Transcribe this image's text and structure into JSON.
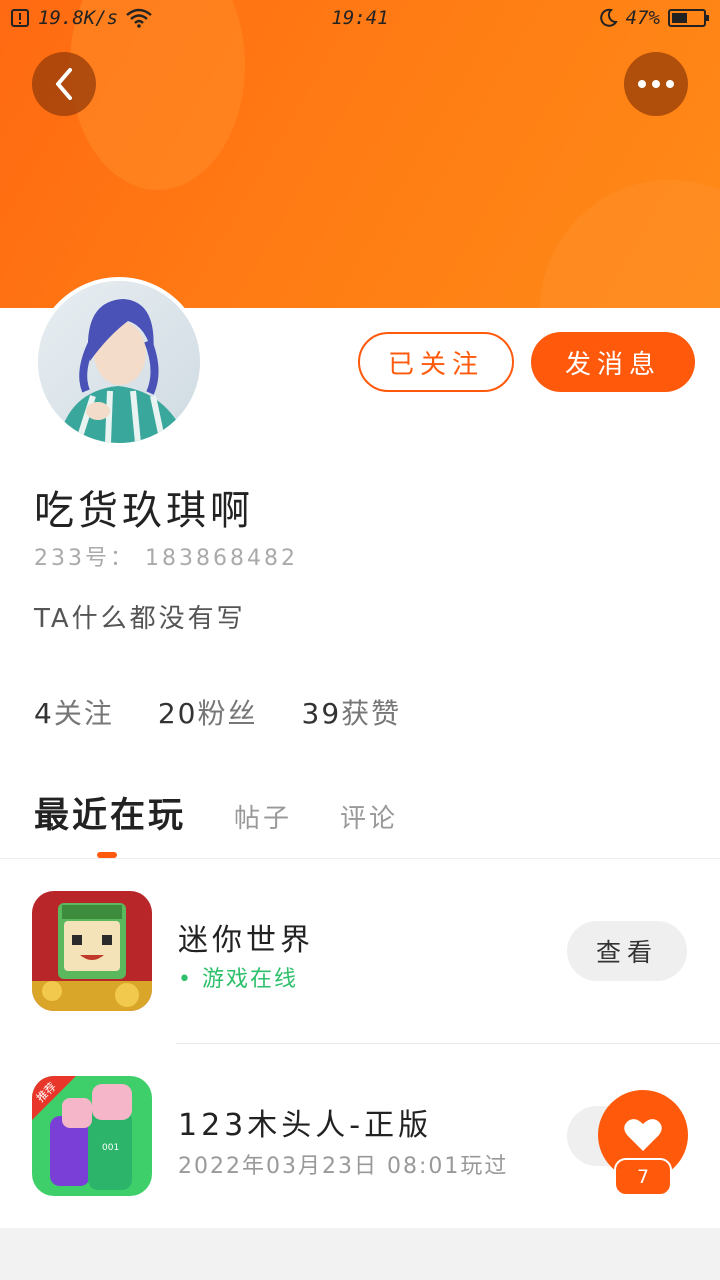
{
  "status_bar": {
    "network_speed": "19.8K/s",
    "time": "19:41",
    "battery": "47%",
    "battery_level": 0.47
  },
  "header": {
    "back_icon": "chevron-left-icon",
    "more_icon": "more-horizontal-icon"
  },
  "profile": {
    "username": "吃货玖琪啊",
    "uid": "233号： 183868482",
    "bio": "TA什么都没有写",
    "follow_button": "已关注",
    "message_button": "发消息",
    "stats": [
      {
        "num": "4",
        "label": "关注"
      },
      {
        "num": "20",
        "label": "粉丝"
      },
      {
        "num": "39",
        "label": "获赞"
      }
    ]
  },
  "tabs": [
    {
      "label": "最近在玩",
      "active": true
    },
    {
      "label": "帖子",
      "active": false
    },
    {
      "label": "评论",
      "active": false
    }
  ],
  "games": [
    {
      "name": "迷你世界",
      "subtitle": "游戏在线",
      "button": "查看"
    },
    {
      "name": "123木头人-正版",
      "subtitle": "2022年03月23日 08:01玩过",
      "badge": "推荐",
      "jersey": "001"
    }
  ],
  "like": {
    "icon": "heart-icon",
    "count": "7"
  },
  "colors": {
    "accent": "#ff5a0c",
    "online": "#2ec06a"
  }
}
